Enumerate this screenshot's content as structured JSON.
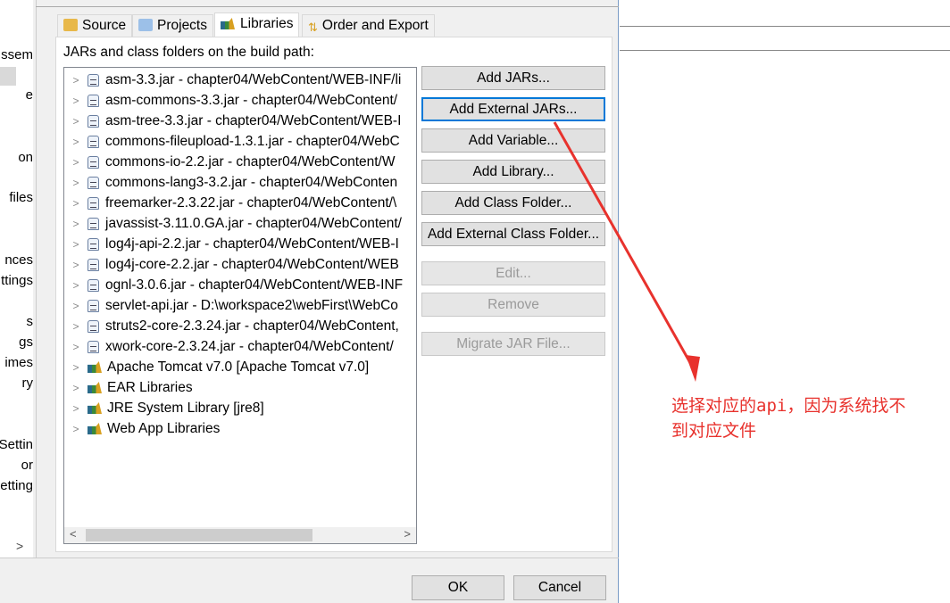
{
  "sidebar": {
    "fragments": [
      "ssem",
      "e",
      "on",
      "files",
      "nces",
      "ttings",
      "s",
      "gs",
      "imes",
      "ry",
      "Settin",
      "or",
      "etting"
    ]
  },
  "tabs": [
    {
      "label": "Source",
      "icon": "source-folder-icon"
    },
    {
      "label": "Projects",
      "icon": "projects-folder-icon"
    },
    {
      "label": "Libraries",
      "icon": "libraries-icon",
      "active": true
    },
    {
      "label": "Order and Export",
      "icon": "order-export-icon"
    }
  ],
  "panel": {
    "label": "JARs and class folders on the build path:"
  },
  "tree": [
    {
      "label": "asm-3.3.jar - chapter04/WebContent/WEB-INF/li",
      "icon": "jar"
    },
    {
      "label": "asm-commons-3.3.jar - chapter04/WebContent/",
      "icon": "jar"
    },
    {
      "label": "asm-tree-3.3.jar - chapter04/WebContent/WEB-I",
      "icon": "jar"
    },
    {
      "label": "commons-fileupload-1.3.1.jar - chapter04/WebC",
      "icon": "jar"
    },
    {
      "label": "commons-io-2.2.jar - chapter04/WebContent/W",
      "icon": "jar"
    },
    {
      "label": "commons-lang3-3.2.jar - chapter04/WebConten",
      "icon": "jar"
    },
    {
      "label": "freemarker-2.3.22.jar - chapter04/WebContent/\\",
      "icon": "jar"
    },
    {
      "label": "javassist-3.11.0.GA.jar - chapter04/WebContent/",
      "icon": "jar"
    },
    {
      "label": "log4j-api-2.2.jar - chapter04/WebContent/WEB-I",
      "icon": "jar"
    },
    {
      "label": "log4j-core-2.2.jar - chapter04/WebContent/WEB",
      "icon": "jar"
    },
    {
      "label": "ognl-3.0.6.jar - chapter04/WebContent/WEB-INF",
      "icon": "jar"
    },
    {
      "label": "servlet-api.jar - D:\\workspace2\\webFirst\\WebCo",
      "icon": "jar"
    },
    {
      "label": "struts2-core-2.3.24.jar - chapter04/WebContent,",
      "icon": "jar"
    },
    {
      "label": "xwork-core-2.3.24.jar - chapter04/WebContent/",
      "icon": "jar"
    },
    {
      "label": "Apache Tomcat v7.0 [Apache Tomcat v7.0]",
      "icon": "library"
    },
    {
      "label": "EAR Libraries",
      "icon": "library"
    },
    {
      "label": "JRE System Library [jre8]",
      "icon": "library"
    },
    {
      "label": "Web App Libraries",
      "icon": "library"
    }
  ],
  "buttons": [
    {
      "label": "Add JARs...",
      "state": "normal"
    },
    {
      "label": "Add External JARs...",
      "state": "focused"
    },
    {
      "label": "Add Variable...",
      "state": "normal"
    },
    {
      "label": "Add Library...",
      "state": "normal"
    },
    {
      "label": "Add Class Folder...",
      "state": "normal"
    },
    {
      "label": "Add External Class Folder...",
      "state": "normal"
    },
    {
      "label": "Edit...",
      "state": "disabled"
    },
    {
      "label": "Remove",
      "state": "disabled"
    },
    {
      "label": "Migrate JAR File...",
      "state": "disabled"
    }
  ],
  "dialog": {
    "ok": "OK",
    "cancel": "Cancel"
  },
  "annotation": {
    "text": "选择对应的api，因为系统找不\n到对应文件",
    "color": "#e8322d"
  }
}
